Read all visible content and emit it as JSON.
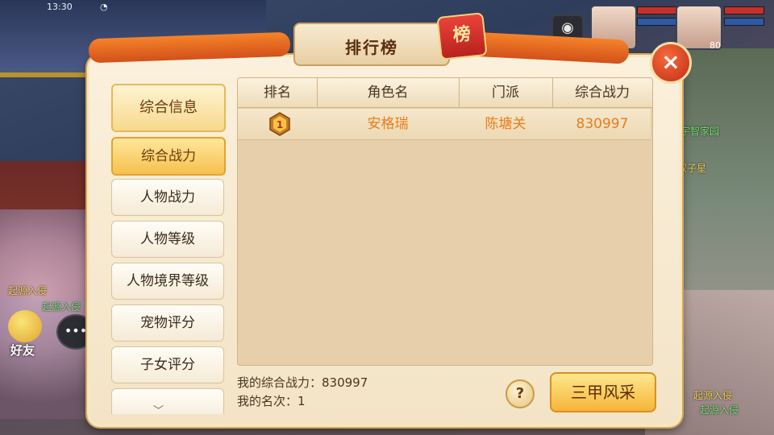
{
  "hud": {
    "time": "13:30",
    "camera_icon": "camera-icon",
    "level": "80"
  },
  "side": {
    "friend_label": "好友",
    "chat_icon": "chat-bubble-icon",
    "texts": [
      "起源入侵",
      "起源入侵",
      "宇智家园",
      "双子星",
      "起源入侵",
      "起源入侵"
    ]
  },
  "dialog": {
    "title": "排行榜",
    "seal": "榜",
    "close_label": "×"
  },
  "tabs": {
    "header": "综合信息",
    "items": [
      "综合战力",
      "人物战力",
      "人物等级",
      "人物境界等级",
      "宠物评分",
      "子女评分"
    ],
    "active_index": 0
  },
  "table": {
    "columns": [
      "排名",
      "角色名",
      "门派",
      "综合战力"
    ],
    "rows": [
      {
        "rank_icon": "rank-medal-1-icon",
        "name": "安格瑞",
        "faction": "陈塘关",
        "power": "830997"
      }
    ]
  },
  "footer": {
    "my_power_label": "我的综合战力：830997",
    "my_rank_label": "我的名次：1",
    "help_label": "?",
    "action_label": "三甲风采"
  },
  "colors": {
    "accent_orange": "#e77d1b",
    "panel_bg": "#f3e4c6"
  }
}
